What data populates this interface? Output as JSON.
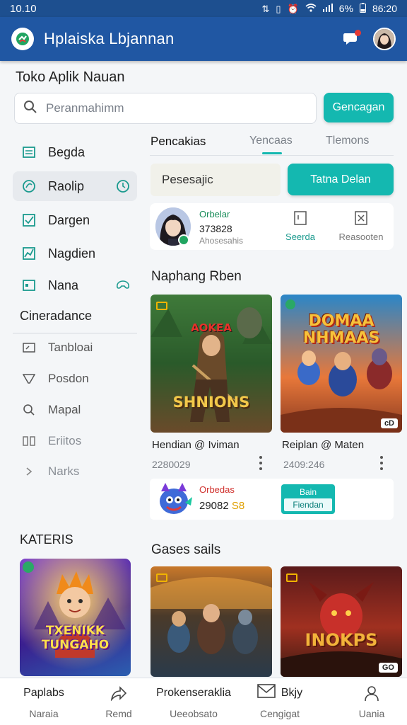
{
  "status": {
    "time": "10.10",
    "battery": "6%",
    "clock": "86:20"
  },
  "appbar": {
    "title": "Hplaiska Lbjannan"
  },
  "page": {
    "title": "Toko Aplik Nauan"
  },
  "search": {
    "placeholder": "Peranmahimm",
    "button": "Gencagan"
  },
  "sidebar": {
    "items": [
      {
        "label": "Begda",
        "icon": "list-icon"
      },
      {
        "label": "Raolip",
        "icon": "leaf-icon"
      },
      {
        "label": "Dargen",
        "icon": "checkbox-icon"
      },
      {
        "label": "Nagdien",
        "icon": "chart-icon"
      },
      {
        "label": "Nana",
        "icon": "calendar-icon"
      }
    ],
    "section_head": "Cineradance",
    "sub_items": [
      {
        "label": "Tanbloai",
        "icon": "monitor-icon"
      },
      {
        "label": "Posdon",
        "icon": "filter-icon"
      },
      {
        "label": "Mapal",
        "icon": "search-icon"
      },
      {
        "label": "Eriitos",
        "icon": "columns-icon"
      },
      {
        "label": "Narks",
        "icon": "chevron-right-icon"
      }
    ],
    "kat_title": "KATERIS",
    "kat_card_title": "TXENIKK TUNGAHO"
  },
  "tabs": [
    "Pencakias",
    "Yencaas",
    "Tlemons"
  ],
  "promo": {
    "value": "Pesesajic",
    "button": "Tatna Delan"
  },
  "profile": {
    "name": "Orbelar",
    "number": "373828",
    "sub": "Ahosesahis",
    "action1": "Seerda",
    "action2": "Reasooten"
  },
  "section1": {
    "title": "Naphang Rben"
  },
  "games1": [
    {
      "name": "Hendian @ Iviman",
      "stat": "2280029",
      "art_top": "AOKEA",
      "art_bottom": "SHNIONS",
      "tag": ""
    },
    {
      "name": "Reiplan @ Maten",
      "stat": "2409:246",
      "art_top": "DOMAA NHMAAS",
      "art_bottom": "",
      "tag": "cD"
    }
  ],
  "mini": {
    "name": "Orbedas",
    "number": "29082",
    "highlight": "S8",
    "btn_top": "Bain",
    "btn_bottom": "Fiendan"
  },
  "section2": {
    "title": "Gases sails"
  },
  "games2": [
    {
      "art": "",
      "tag": ""
    },
    {
      "art": "INOKPS",
      "tag": "GO"
    }
  ],
  "bottomnav": [
    {
      "top": "Paplabs",
      "bottom": "Naraia",
      "icon": ""
    },
    {
      "top": "",
      "bottom": "Remd",
      "icon": "share-icon"
    },
    {
      "top": "Prokenseraklia",
      "bottom": "Ueeobsato",
      "icon": ""
    },
    {
      "top": "Bkjy",
      "bottom": "Cengigat",
      "icon": "mail-icon"
    },
    {
      "top": "",
      "bottom": "Uania",
      "icon": "user-icon"
    }
  ],
  "colors": {
    "primary": "#2057a3",
    "accent": "#14b8b0",
    "status": "#1d4f8f"
  }
}
